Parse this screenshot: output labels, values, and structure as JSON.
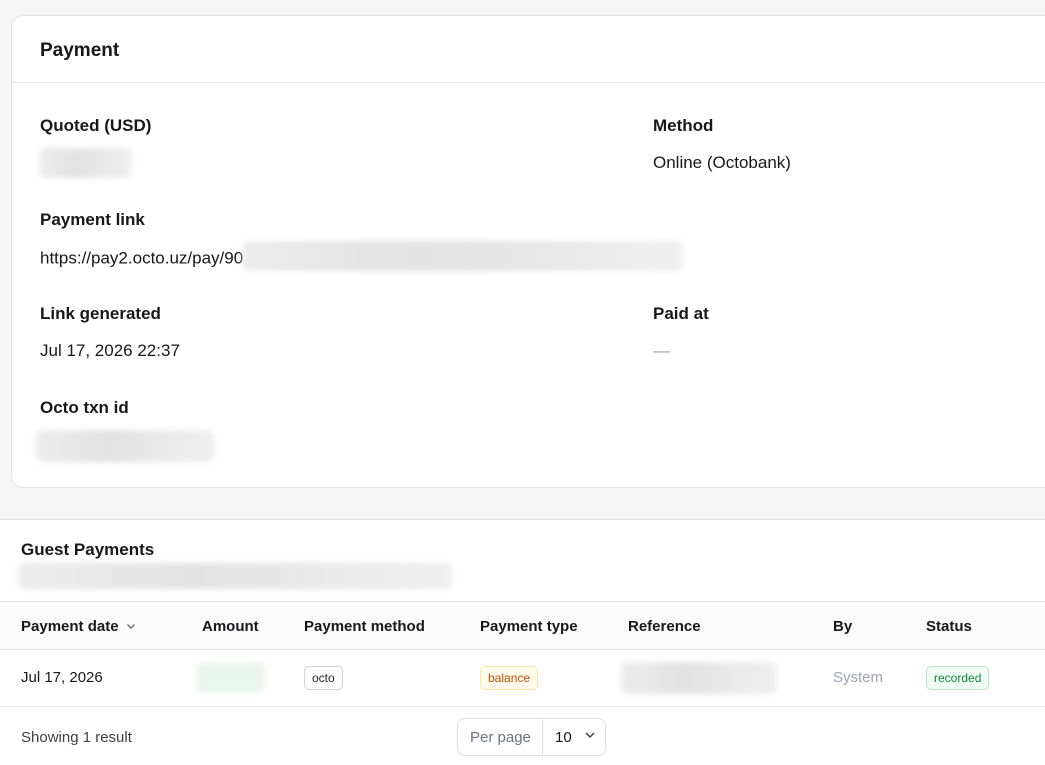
{
  "payment": {
    "title": "Payment",
    "quoted_label": "Quoted (USD)",
    "method_label": "Method",
    "method_value": "Online (Octobank)",
    "link_label": "Payment link",
    "link_value": "https://pay2.octo.uz/pay/90",
    "generated_label": "Link generated",
    "generated_value": "Jul 17, 2026 22:37",
    "paid_at_label": "Paid at",
    "paid_at_value": "—",
    "txn_label": "Octo txn id"
  },
  "guest_payments": {
    "title": "Guest Payments",
    "columns": {
      "date": "Payment date",
      "amount": "Amount",
      "method": "Payment method",
      "type": "Payment type",
      "reference": "Reference",
      "by": "By",
      "status": "Status"
    },
    "rows": [
      {
        "date": "Jul 17, 2026",
        "method": "octo",
        "type": "balance",
        "by": "System",
        "status": "recorded"
      }
    ],
    "footer": {
      "showing": "Showing 1 result",
      "per_page_label": "Per page",
      "per_page_value": "10"
    }
  },
  "icons": {
    "sort": "chevron-down-icon",
    "select": "chevron-down-icon"
  },
  "colors": {
    "type_badge": "#b45309",
    "status_badge": "#15803d"
  }
}
